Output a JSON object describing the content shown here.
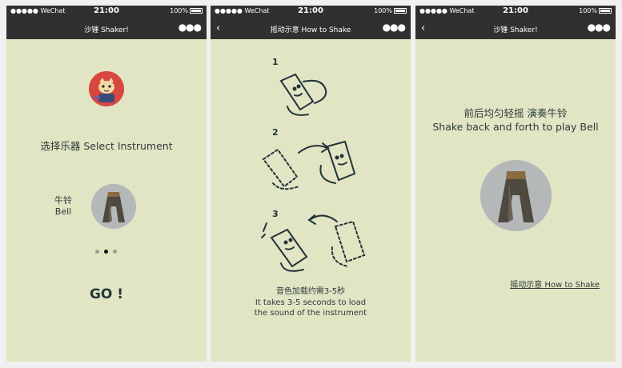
{
  "status": {
    "carrier": "●●●●● WeChat",
    "time": "21:00",
    "battery": "100%"
  },
  "screen1": {
    "nav_title": "沙锤 Shaker!",
    "select_label": "选择乐器 Select Instrument",
    "instrument_name_zh": "牛铃",
    "instrument_name_en": "Bell",
    "go_label": "GO !"
  },
  "screen2": {
    "nav_title": "摇动示意 How to Shake",
    "step_numbers": [
      "1",
      "2",
      "3"
    ],
    "load_text_zh": "音色加载约需3-5秒",
    "load_text_en_1": "It takes 3-5 seconds to load",
    "load_text_en_2": "the sound of the instrument"
  },
  "screen3": {
    "nav_title": "沙锤 Shaker!",
    "shake_text_zh": "前后均匀轻摇 演奏牛铃",
    "shake_text_en": "Shake back and forth to play Bell",
    "howto_link": "摇动示意 How to Shake"
  },
  "icons": {
    "back": "chevron-left-icon",
    "more": "more-dots-icon",
    "wifi": "wifi-icon",
    "battery": "battery-icon"
  },
  "colors": {
    "background": "#e1e5c4",
    "navbar": "#303030",
    "text": "#2d3a3a",
    "avatar_bg": "#d8473e"
  }
}
